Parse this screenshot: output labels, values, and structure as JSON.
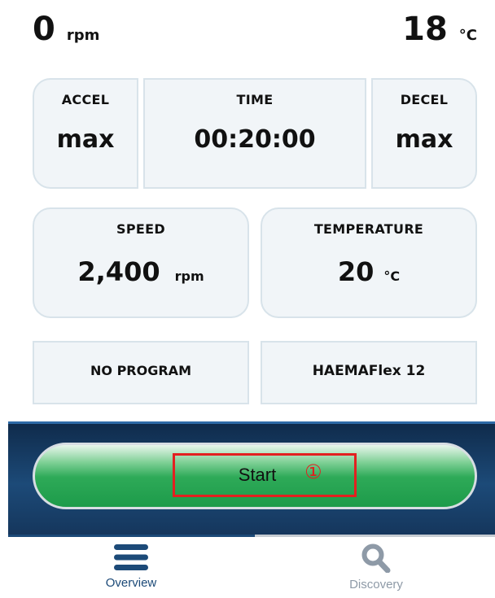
{
  "status": {
    "speed_value": "0",
    "speed_unit": "rpm",
    "temp_value": "18",
    "temp_unit": "°C"
  },
  "tiles": {
    "accel": {
      "label": "ACCEL",
      "value": "max"
    },
    "time": {
      "label": "TIME",
      "value": "00:20:00"
    },
    "decel": {
      "label": "DECEL",
      "value": "max"
    },
    "speed": {
      "label": "SPEED",
      "value": "2,400",
      "unit": "rpm"
    },
    "temperature": {
      "label": "TEMPERATURE",
      "value": "20",
      "unit": "°C"
    },
    "program": {
      "label": "NO PROGRAM"
    },
    "device": {
      "label": "HAEMAFlex 12"
    }
  },
  "start_button": {
    "label": "Start",
    "annotation": "①"
  },
  "nav": {
    "items": [
      {
        "label": "Overview",
        "icon": "hamburger-icon",
        "active": true
      },
      {
        "label": "Discovery",
        "icon": "search-icon",
        "active": false
      }
    ]
  },
  "colors": {
    "accent": "#1c4a78",
    "start_green": "#1d9b4a",
    "highlight_red": "#e32020",
    "tile_bg": "#f1f5f8"
  }
}
